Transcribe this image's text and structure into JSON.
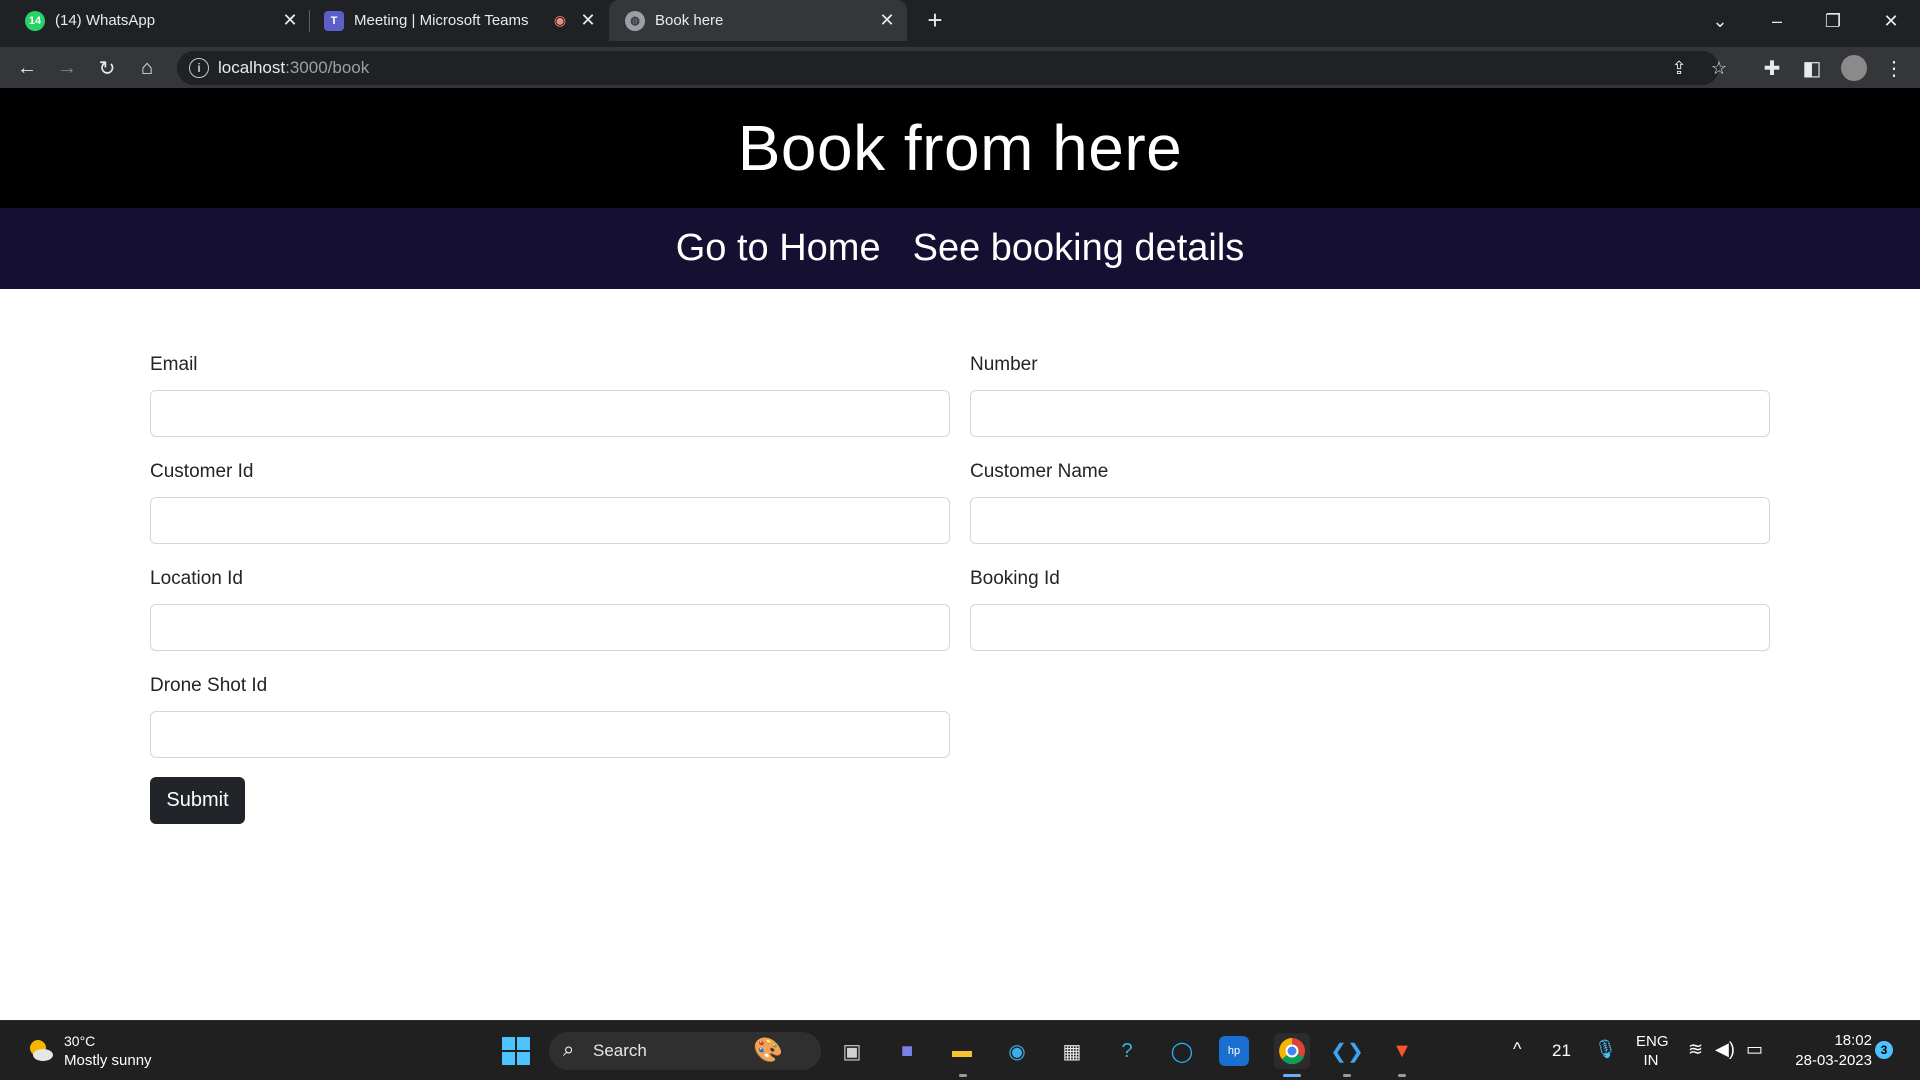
{
  "browser": {
    "tabs": [
      {
        "title": "(14) WhatsApp",
        "favicon_text": "14",
        "icon": "whatsapp-icon"
      },
      {
        "title": "Meeting | Microsoft Teams",
        "favicon_text": "T",
        "icon": "teams-icon"
      },
      {
        "title": "Book here",
        "favicon_text": "",
        "icon": "globe-icon"
      }
    ],
    "url_host": "localhost",
    "url_path": ":3000/book"
  },
  "page": {
    "header_title": "Book from here",
    "nav": {
      "home": "Go to Home",
      "booking_details": "See booking details"
    },
    "form": {
      "email_label": "Email",
      "number_label": "Number",
      "customer_id_label": "Customer Id",
      "customer_name_label": "Customer Name",
      "location_id_label": "Location Id",
      "booking_id_label": "Booking Id",
      "drone_shot_id_label": "Drone Shot Id",
      "submit_label": "Submit"
    },
    "colors": {
      "header_bg": "#000000",
      "nav_bg": "#150f32",
      "submit_bg": "#212529"
    }
  },
  "taskbar": {
    "weather_temp": "30°C",
    "weather_desc": "Mostly sunny",
    "search_label": "Search",
    "tray_number": "21",
    "lang_line1": "ENG",
    "lang_line2": "IN",
    "time": "18:02",
    "date": "28-03-2023",
    "notification_count": "3"
  }
}
